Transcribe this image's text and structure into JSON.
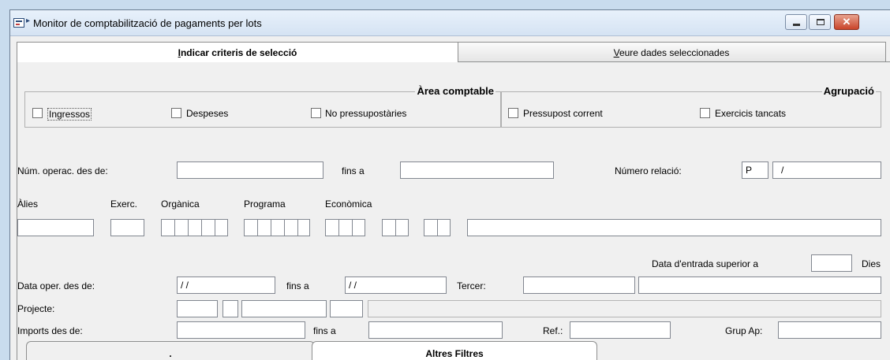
{
  "window": {
    "title": "Monitor de comptabilització de pagaments per lots",
    "close_glyph": "✕",
    "title_arrow": "▸"
  },
  "tabs": [
    {
      "label": "Indicar criteris de selecció",
      "mnemonic": "I",
      "rest": "ndicar criteris de selecció",
      "active": true
    },
    {
      "label": "Veure dades seleccionades",
      "mnemonic": "V",
      "rest": "eure dades seleccionades",
      "active": false
    }
  ],
  "area_comptable": {
    "title": "Àrea comptable",
    "options": [
      {
        "label": "Ingressos",
        "checked": false
      },
      {
        "label": "Despeses",
        "checked": false
      },
      {
        "label": "No pressupostàries",
        "checked": false
      }
    ]
  },
  "agrupacio": {
    "title": "Agrupació",
    "options": [
      {
        "label": "Pressupost corrent",
        "checked": false
      },
      {
        "label": "Exercicis tancats",
        "checked": false
      }
    ]
  },
  "operacions": {
    "label": "Núm. operac. des de:",
    "from_value": "",
    "to_label": "fins a",
    "to_value": "",
    "relacio_label": "Número relació:",
    "relacio_prefix": "P",
    "relacio_value": "/"
  },
  "aplicacio": {
    "labels": [
      "Àlies",
      "Exerc.",
      "Orgànica",
      "Programa",
      "Econòmica"
    ],
    "alies": "",
    "exerc": "",
    "description": ""
  },
  "data_entrada": {
    "label": "Data d'entrada superior a",
    "value": "",
    "unit": "Dies"
  },
  "data_oper": {
    "label": "Data oper. des de:",
    "from_value": "/ /",
    "to_label": "fins a",
    "to_value": "/ /",
    "tercer_label": "Tercer:",
    "tercer_code": "",
    "tercer_name": ""
  },
  "projecte": {
    "label": "Projecte:",
    "description": ""
  },
  "imports": {
    "label": "Imports des de:",
    "from_value": "",
    "to_label": "fins a",
    "to_value": "",
    "ref_label": "Ref.:",
    "ref_value": "",
    "grup_label": "Grup Ap:",
    "grup_value": ""
  },
  "bottom_tabs": [
    {
      "label": "."
    },
    {
      "label": "Altres Filtres"
    }
  ]
}
